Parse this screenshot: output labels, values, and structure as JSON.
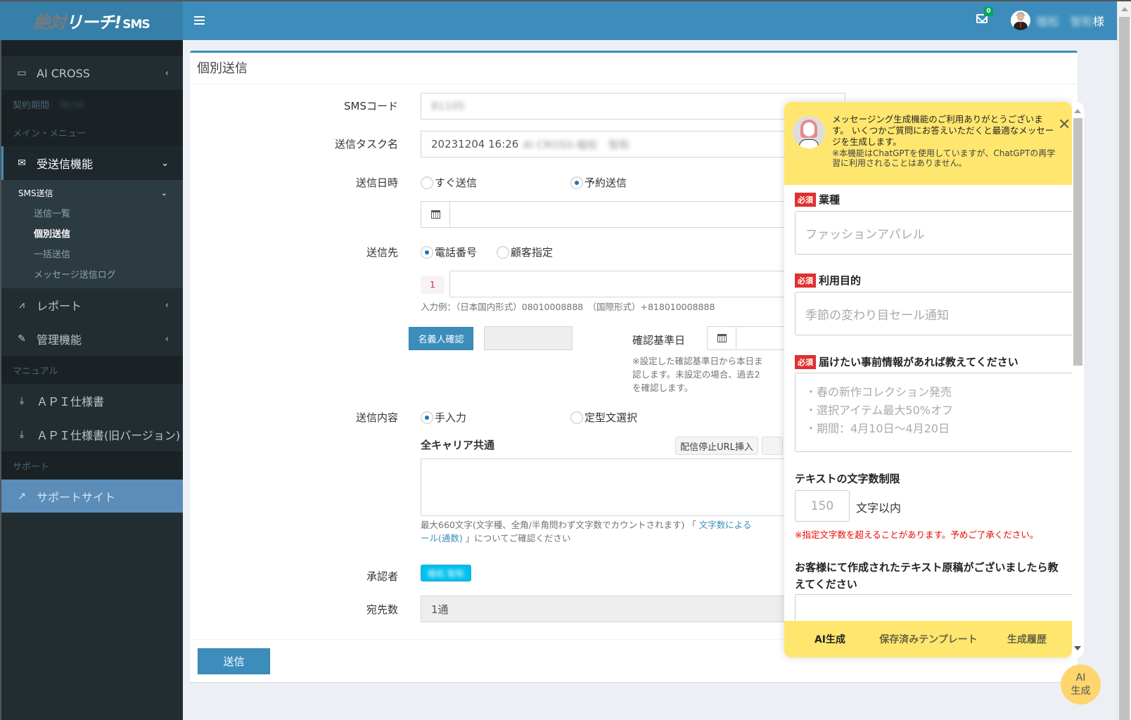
{
  "header": {
    "logo": {
      "part1": "絶対",
      "part2": "リーチ!",
      "part3": "SMS"
    },
    "mail_count": "0",
    "user_name_blurred": "植松　智和",
    "user_suffix": "様",
    "colors": {
      "header": "#3c8dbc",
      "sidebar": "#222d32",
      "accent": "#3c8dbc"
    }
  },
  "sidebar": {
    "company": "AI CROSS",
    "contract_label": "契約期間",
    "contract_value_blurred": "：36/36",
    "main_menu_header": "メイン・メニュー",
    "messaging": "受送信機能",
    "sms_send": "SMS送信",
    "sub_items": [
      "送信一覧",
      "個別送信",
      "一括送信",
      "メッセージ送信ログ"
    ],
    "report": "レポート",
    "admin": "管理機能",
    "manual_header": "マニュアル",
    "api_spec": "ＡＰＩ仕様書",
    "api_spec_old": "ＡＰＩ仕様書(旧バージョン)",
    "support_header": "サポート",
    "support_site": "サポートサイト"
  },
  "form": {
    "title": "個別送信",
    "sms_code_label": "SMSコード",
    "sms_code_value_blurred": "81105",
    "task_name_label": "送信タスク名",
    "task_name_value": "20231204 16:26",
    "task_name_blurred": "AI CROSS-植松　智和",
    "send_time_label": "送信日時",
    "send_now": "すぐ送信",
    "send_scheduled": "予約送信",
    "send_time_selected": "予約送信",
    "recipient_label": "送信先",
    "recipient_phone": "電話番号",
    "recipient_customer": "顧客指定",
    "recipient_selected": "電話番号",
    "row_number": "1",
    "phone_example": "入力例：（日本国内形式）08010008888　（国際形式）+818010008888",
    "holder_check_button": "名義人確認",
    "check_date_label": "確認基準日",
    "check_date_note_1": "※設定した確認基準日から本日ま",
    "check_date_note_2": "認します。未設定の場合、過去2",
    "check_date_note_3": "を確認します。",
    "content_label": "送信内容",
    "content_manual": "手入力",
    "content_template": "定型文選択",
    "content_selected": "手入力",
    "all_carriers": "全キャリア共通",
    "insert_stop_url": "配信停止URL挿入",
    "max_chars_note": "最大660文字(文字種、全角/半角問わず文字数でカウントされます) 「",
    "max_chars_link_1": "文字数による",
    "max_chars_link_2": "ール(通数)",
    "max_chars_note_end": "」についてご確認ください",
    "approver_label": "承認者",
    "approver_blurred": "植松 智和",
    "recipients_count_label": "宛先数",
    "recipients_count_value": "1通",
    "submit": "送信"
  },
  "ai_panel": {
    "intro": "メッセージング生成機能のご利用ありがとうございます。 いくつかご質問にお答えいただくと最適なメッセージを生成します。",
    "note": "※本機能はChatGPTを使用していますが、ChatGPTの再学習に利用されることはありません。",
    "required_badge": "必須",
    "industry_label": "業種",
    "industry_placeholder": "ファッションアパレル",
    "purpose_label": "利用目的",
    "purpose_placeholder": "季節の変わり目セール通知",
    "info_label": "届けたい事前情報があれば教えてください",
    "info_placeholder_lines": [
      "・春の新作コレクション発売",
      "・選択アイテム最大50%オフ",
      "・期間：4月10日〜4月20日"
    ],
    "char_limit_label": "テキストの文字数制限",
    "char_limit_placeholder": "150",
    "char_limit_suffix": "文字以内",
    "char_limit_warning": "※指定文字数を超えることがあります。予めご了承ください。",
    "draft_label": "お客様にて作成されたテキスト原稿がございましたら教えてください",
    "tabs": [
      "AI生成",
      "保存済みテンプレート",
      "生成履歴"
    ],
    "active_tab": "AI生成",
    "fab_line1": "AI",
    "fab_line2": "生成"
  }
}
